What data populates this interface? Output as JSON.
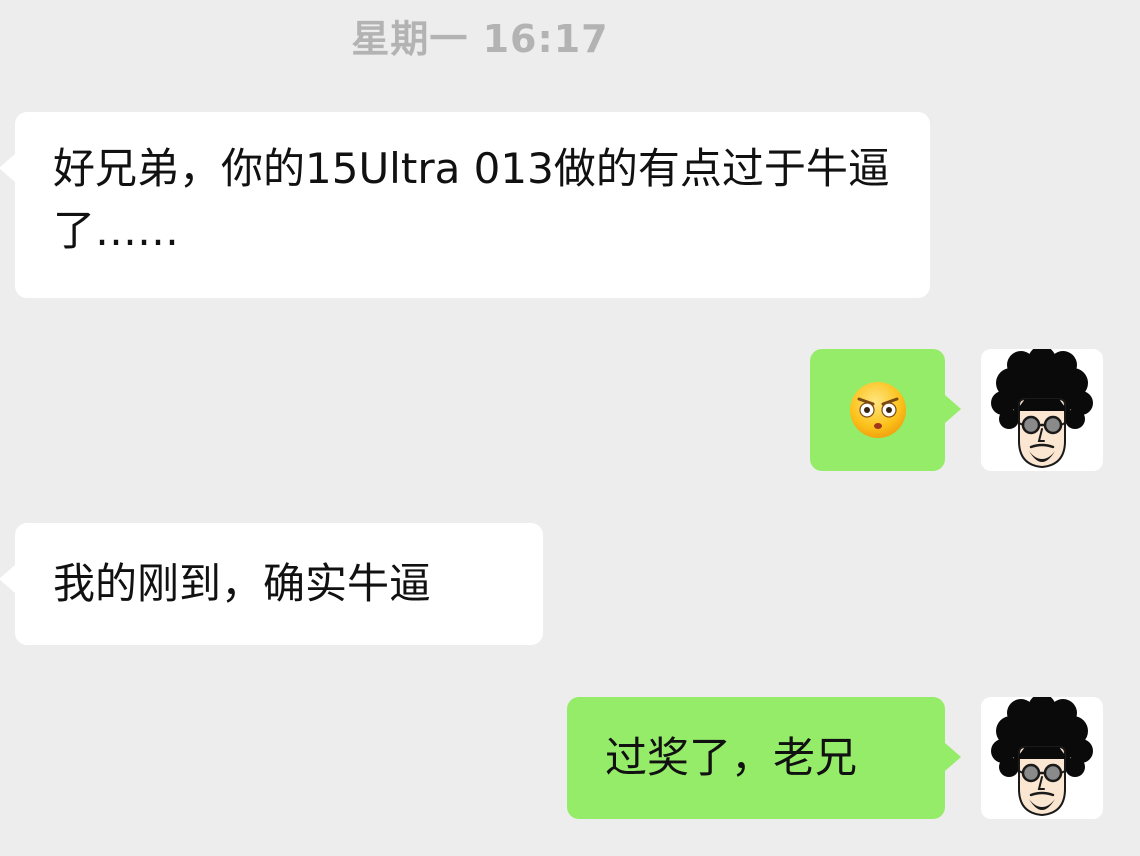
{
  "timestamp": "星期一 16:17",
  "messages": [
    {
      "side": "left",
      "text": "好兄弟，你的15Ultra 013做的有点过于牛逼了……"
    },
    {
      "side": "right",
      "emoji": "flushed-face-emoji"
    },
    {
      "side": "left",
      "text": "我的刚到，确实牛逼"
    },
    {
      "side": "right",
      "text": "过奖了，老兄"
    }
  ],
  "colors": {
    "background": "#ededed",
    "incoming_bubble": "#ffffff",
    "outgoing_bubble": "#95ec69",
    "timestamp": "#b3b3b3",
    "text": "#111111"
  },
  "avatar": {
    "icon": "afro-sunglasses-avatar"
  }
}
